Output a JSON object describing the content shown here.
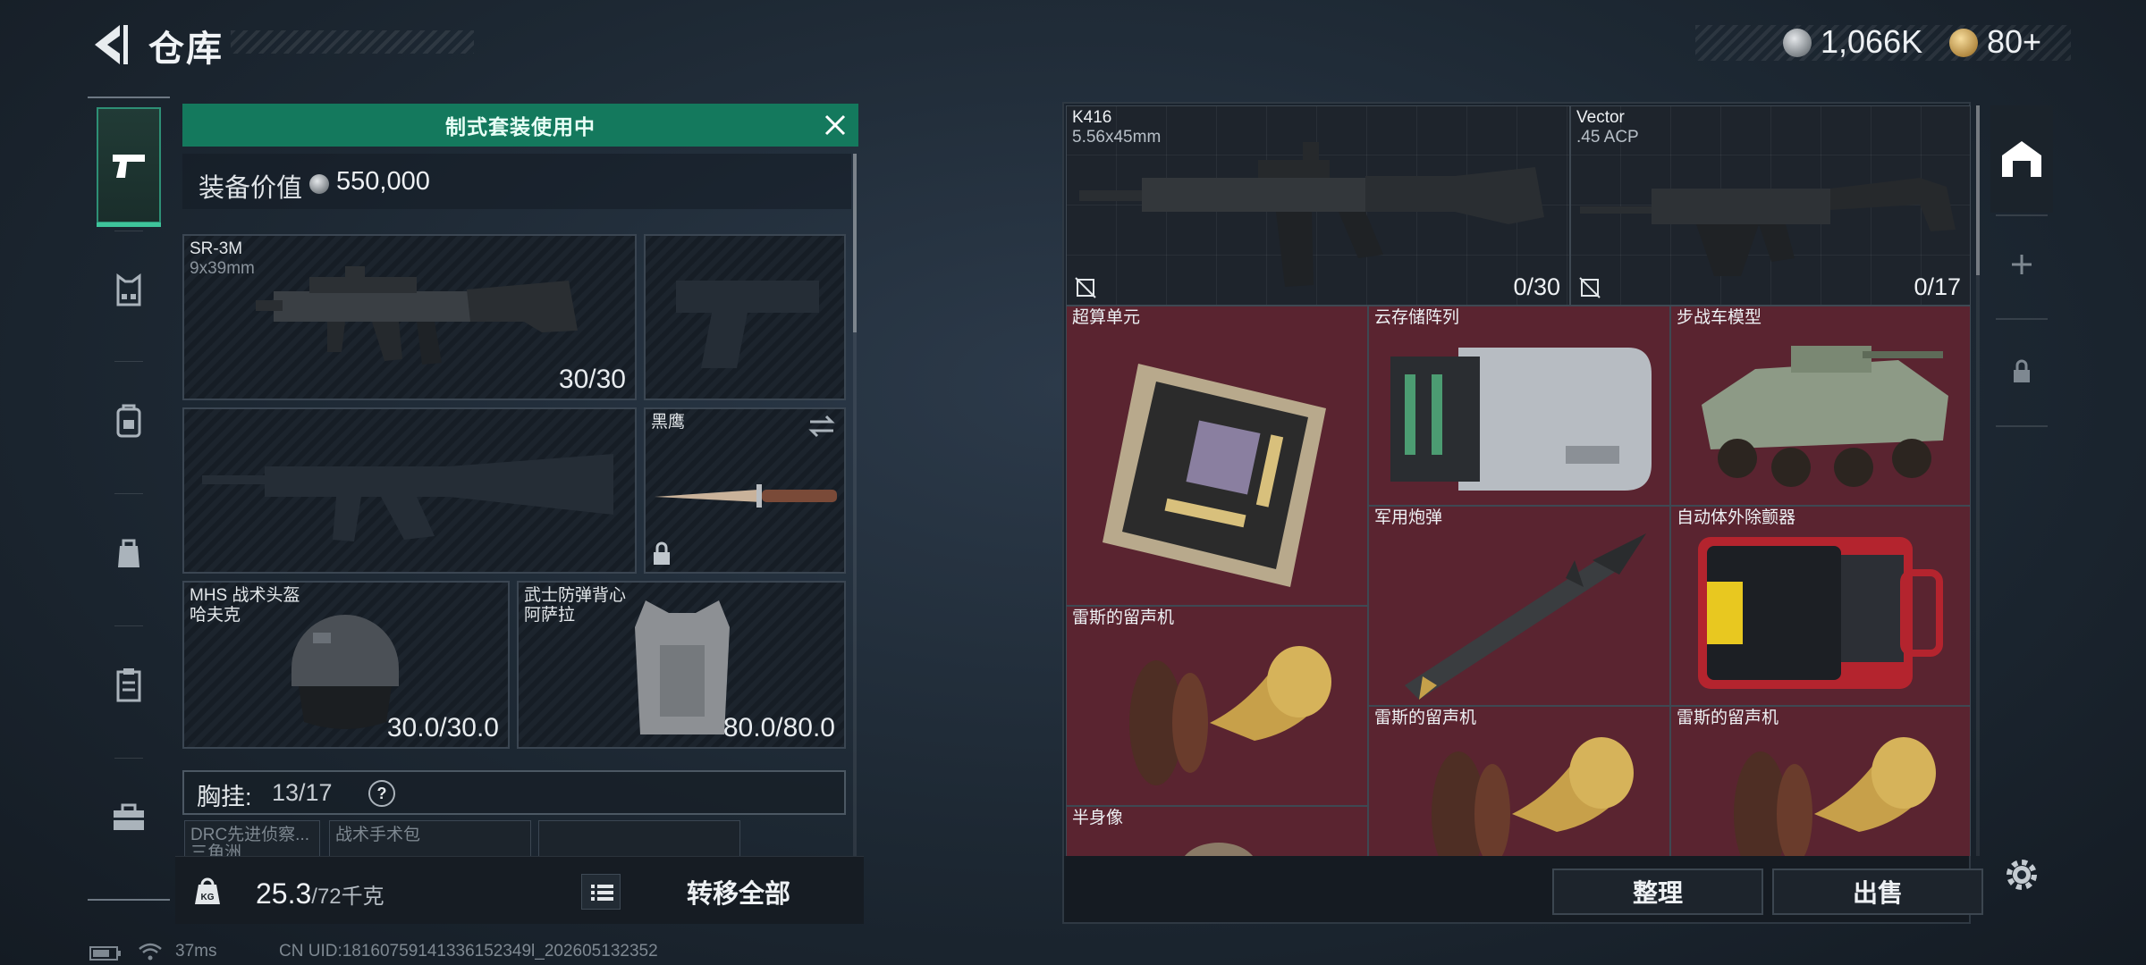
{
  "header": {
    "title": "仓库",
    "currencies": [
      {
        "name": "silver-coin",
        "value": "1,066K"
      },
      {
        "name": "gold-coin",
        "value": "80+"
      }
    ]
  },
  "rail": {
    "items": [
      {
        "name": "weapons",
        "icon": "pistol-icon",
        "active": true
      },
      {
        "name": "armor",
        "icon": "vest-icon"
      },
      {
        "name": "backpack",
        "icon": "backpack-icon"
      },
      {
        "name": "bag",
        "icon": "pouch-icon"
      },
      {
        "name": "clipboard",
        "icon": "clipboard-icon"
      },
      {
        "name": "case",
        "icon": "briefcase-icon"
      }
    ]
  },
  "loadout": {
    "banner": "制式套装使用中",
    "value_label": "装备价值",
    "value": "550,000",
    "primary": {
      "name": "SR-3M",
      "caliber": "9x39mm",
      "ammo": "30/30"
    },
    "knife": {
      "name": "黑鹰"
    },
    "helmet": {
      "name": "MHS 战术头盔",
      "sub": "哈夫克",
      "durability": "30.0/30.0"
    },
    "vest": {
      "name": "武士防弹背心",
      "sub": "阿萨拉",
      "durability": "80.0/80.0"
    },
    "chest_label": "胸挂:",
    "chest_count": "13/17",
    "chest_help": "?",
    "chest_items": [
      "DRC先进侦察...",
      "战术手术包",
      ""
    ],
    "chest_item_sub": "三角洲",
    "weight": "25.3",
    "weight_max": "/72千克",
    "weight_unit_icon": "KG",
    "transfer_all": "转移全部"
  },
  "storage": {
    "guns": [
      {
        "name": "K416",
        "caliber": "5.56x45mm",
        "ammo": "0/30"
      },
      {
        "name": "Vector",
        "caliber": ".45 ACP",
        "ammo": "0/17"
      }
    ],
    "items": [
      {
        "name": "超算单元"
      },
      {
        "name": "云存储阵列"
      },
      {
        "name": "步战车模型"
      },
      {
        "name": "军用炮弹"
      },
      {
        "name": "自动体外除颤器"
      },
      {
        "name": "雷斯的留声机"
      },
      {
        "name": "雷斯的留声机"
      },
      {
        "name": "雷斯的留声机"
      },
      {
        "name": "半身像"
      }
    ],
    "sort_button": "整理",
    "sell_button": "出售"
  },
  "status": {
    "ping": "37ms",
    "uid": "CN UID:18160759141336152349l_202605132352"
  },
  "colors": {
    "accent_green": "#14795d",
    "loot_red": "#5a2430",
    "panel_bg": "#1e242c"
  }
}
